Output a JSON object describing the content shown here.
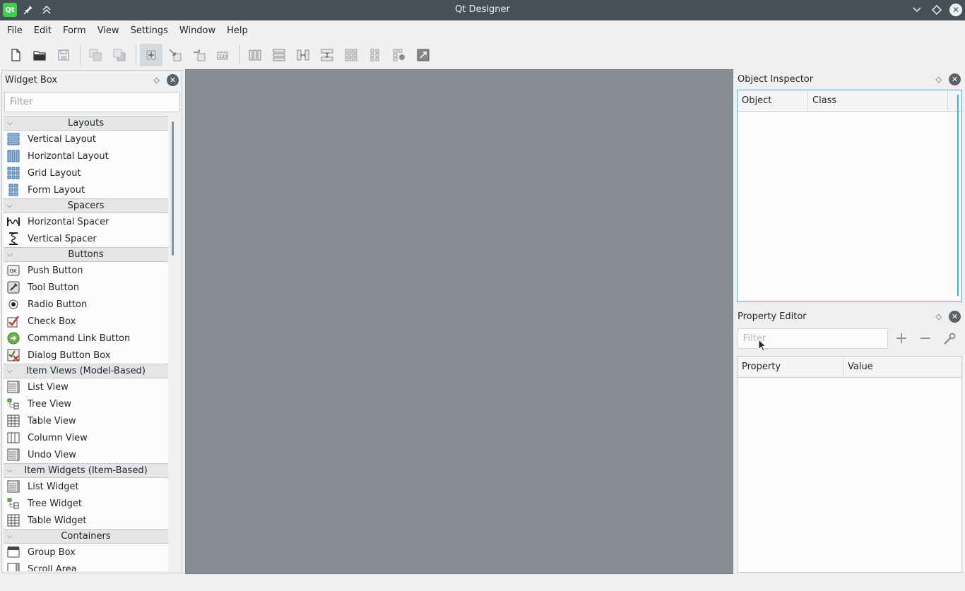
{
  "window": {
    "title": "Qt Designer",
    "app_icon_text": "Qt"
  },
  "menubar": [
    "File",
    "Edit",
    "Form",
    "View",
    "Settings",
    "Window",
    "Help"
  ],
  "toolbar": {
    "icons": [
      "new-form-icon",
      "open-form-icon",
      "save-form-icon",
      "send-to-back-icon",
      "bring-to-front-icon",
      "edit-widgets-icon",
      "edit-signals-slots-icon",
      "edit-buddies-icon",
      "edit-tab-order-icon",
      "lay-out-horizontally-icon",
      "lay-out-vertically-icon",
      "lay-out-horizontally-splitter-icon",
      "lay-out-vertically-splitter-icon",
      "lay-out-grid-icon",
      "lay-out-form-icon",
      "break-layout-icon",
      "adjust-size-icon"
    ]
  },
  "widget_box": {
    "title": "Widget Box",
    "filter_placeholder": "Filter",
    "categories": [
      {
        "name": "Layouts",
        "items": [
          {
            "label": "Vertical Layout",
            "icon": "vertical-layout-icon"
          },
          {
            "label": "Horizontal Layout",
            "icon": "horizontal-layout-icon"
          },
          {
            "label": "Grid Layout",
            "icon": "grid-layout-icon"
          },
          {
            "label": "Form Layout",
            "icon": "form-layout-icon"
          }
        ]
      },
      {
        "name": "Spacers",
        "items": [
          {
            "label": "Horizontal Spacer",
            "icon": "horizontal-spacer-icon"
          },
          {
            "label": "Vertical Spacer",
            "icon": "vertical-spacer-icon"
          }
        ]
      },
      {
        "name": "Buttons",
        "items": [
          {
            "label": "Push Button",
            "icon": "push-button-icon"
          },
          {
            "label": "Tool Button",
            "icon": "tool-button-icon"
          },
          {
            "label": "Radio Button",
            "icon": "radio-button-icon"
          },
          {
            "label": "Check Box",
            "icon": "check-box-icon"
          },
          {
            "label": "Command Link Button",
            "icon": "command-link-button-icon"
          },
          {
            "label": "Dialog Button Box",
            "icon": "dialog-button-box-icon"
          }
        ]
      },
      {
        "name": "Item Views (Model-Based)",
        "items": [
          {
            "label": "List View",
            "icon": "list-view-icon"
          },
          {
            "label": "Tree View",
            "icon": "tree-view-icon"
          },
          {
            "label": "Table View",
            "icon": "table-view-icon"
          },
          {
            "label": "Column View",
            "icon": "column-view-icon"
          },
          {
            "label": "Undo View",
            "icon": "undo-view-icon"
          }
        ]
      },
      {
        "name": "Item Widgets (Item-Based)",
        "items": [
          {
            "label": "List Widget",
            "icon": "list-widget-icon"
          },
          {
            "label": "Tree Widget",
            "icon": "tree-widget-icon"
          },
          {
            "label": "Table Widget",
            "icon": "table-widget-icon"
          }
        ]
      },
      {
        "name": "Containers",
        "items": [
          {
            "label": "Group Box",
            "icon": "group-box-icon"
          },
          {
            "label": "Scroll Area",
            "icon": "scroll-area-icon"
          }
        ]
      }
    ]
  },
  "object_inspector": {
    "title": "Object Inspector",
    "columns": [
      "Object",
      "Class"
    ]
  },
  "property_editor": {
    "title": "Property Editor",
    "filter_placeholder": "Filter",
    "columns": [
      "Property",
      "Value"
    ]
  },
  "colors": {
    "titlebar": "#475057",
    "central": "#888e94",
    "accent": "#3daee9"
  }
}
